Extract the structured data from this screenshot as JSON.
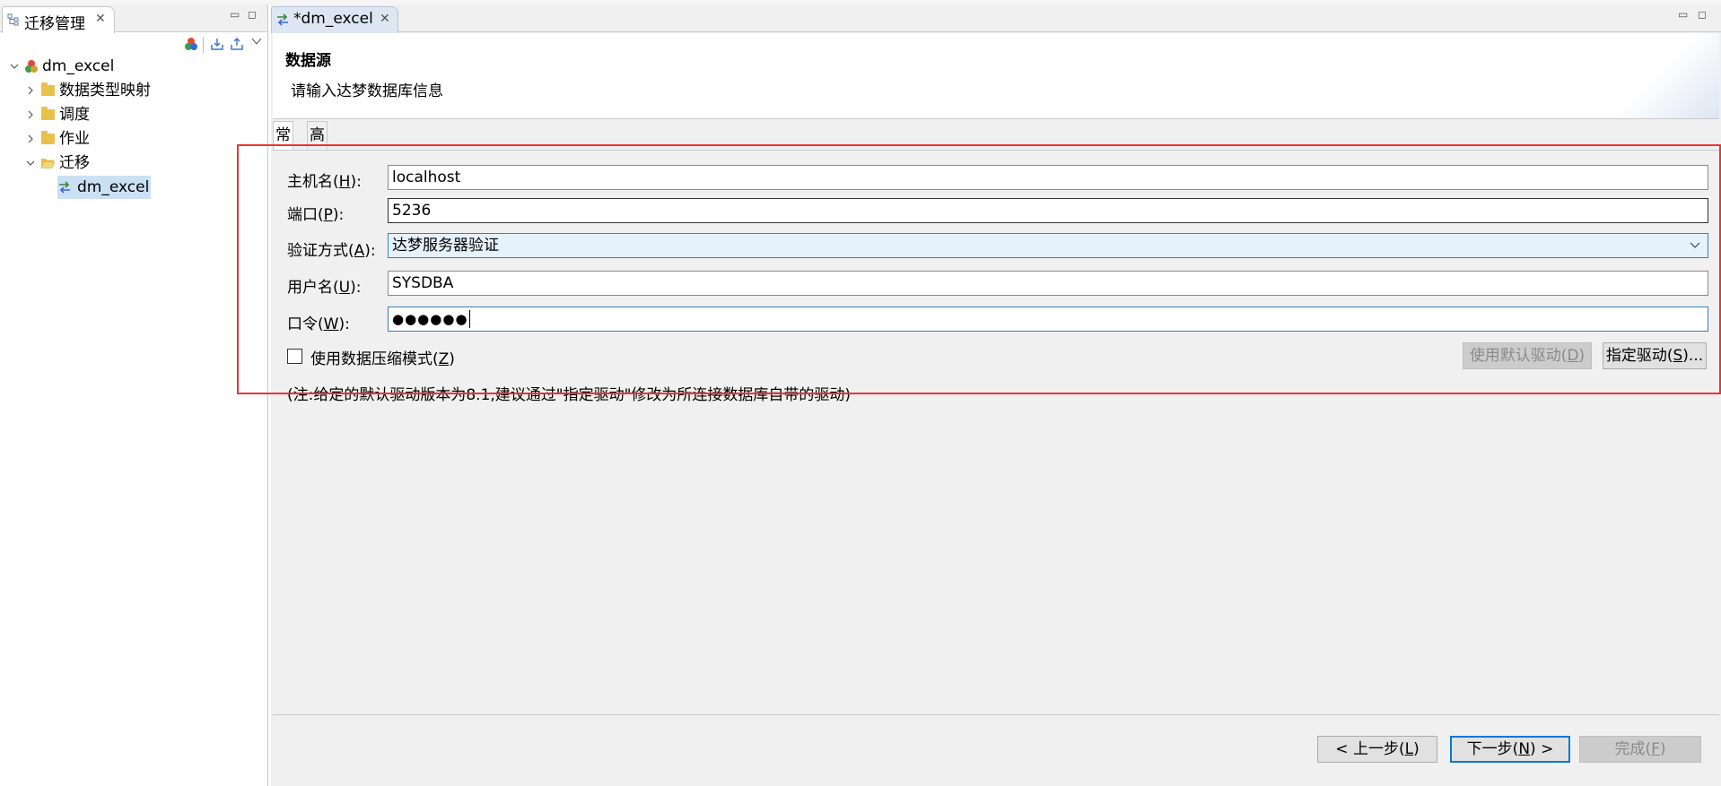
{
  "left_view": {
    "tab_title": "迁移管理",
    "tree": {
      "root": "dm_excel",
      "children": [
        {
          "label": "数据类型映射",
          "expanded": false
        },
        {
          "label": "调度",
          "expanded": false
        },
        {
          "label": "作业",
          "expanded": false
        },
        {
          "label": "迁移",
          "expanded": true
        }
      ],
      "selected_leaf": "dm_excel"
    }
  },
  "editor": {
    "tab_title": "*dm_excel",
    "wizard": {
      "title": "数据源",
      "description": "请输入达梦数据库信息"
    },
    "subtabs": [
      "常规",
      "高级"
    ],
    "form": {
      "host_label": "主机名(",
      "host_mnemonic": "H",
      "host_value": "localhost",
      "port_label": "端口(",
      "port_mnemonic": "P",
      "port_value": "5236",
      "auth_label": "验证方式(",
      "auth_mnemonic": "A",
      "auth_value": "达梦服务器验证",
      "user_label": "用户名(",
      "user_mnemonic": "U",
      "user_value": "SYSDBA",
      "password_label": "口令(",
      "password_mnemonic": "W",
      "password_value": "●●●●●●",
      "label_suffix": "):",
      "compress_label": "使用数据压缩模式(",
      "compress_mnemonic": "Z",
      "compress_checked": false,
      "default_driver_label": "使用默认驱动(",
      "default_driver_mnemonic": "D",
      "specify_driver_label": "指定驱动(",
      "specify_driver_mnemonic": "S",
      "specify_driver_suffix": ")...",
      "note": "(注:给定的默认驱动版本为8.1,建议通过\"指定驱动\"修改为所连接数据库自带的驱动)"
    },
    "buttons": {
      "back_label": "< 上一步(",
      "back_mnemonic": "L",
      "next_label": "下一步(",
      "next_mnemonic": "N",
      "next_suffix": ") >",
      "finish_label": "完成(",
      "finish_mnemonic": "F"
    }
  },
  "colors": {
    "highlight_box": "#e33333",
    "selection": "#cce0f5",
    "focus_border": "#3c7fb1"
  }
}
